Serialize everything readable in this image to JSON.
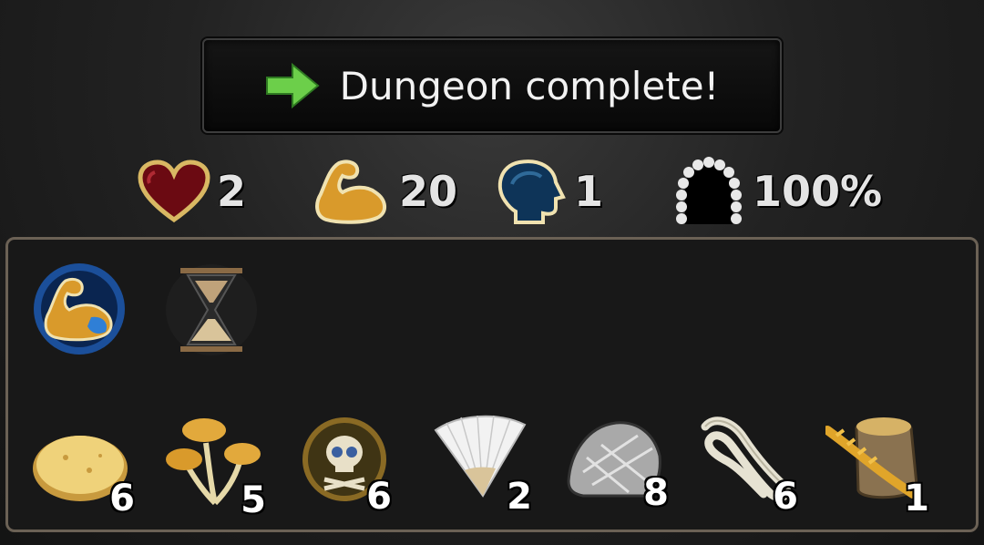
{
  "banner": {
    "title": "Dungeon complete!",
    "icon": "green-arrow-right-icon",
    "icon_color": "#6ccf4a"
  },
  "stats": [
    {
      "icon": "heart-icon",
      "value": "2"
    },
    {
      "icon": "muscle-arm-icon",
      "value": "20"
    },
    {
      "icon": "head-brain-icon",
      "value": "1"
    },
    {
      "icon": "doorway-arch-icon",
      "value": "100%"
    }
  ],
  "buffs": [
    {
      "icon": "strength-buff-icon"
    },
    {
      "icon": "hourglass-icon"
    }
  ],
  "items": [
    {
      "icon": "bread-flatbread-icon",
      "qty": "6"
    },
    {
      "icon": "mushrooms-icon",
      "qty": "5"
    },
    {
      "icon": "skull-coin-icon",
      "qty": "6"
    },
    {
      "icon": "folding-fan-icon",
      "qty": "2"
    },
    {
      "icon": "silver-ore-icon",
      "qty": "8"
    },
    {
      "icon": "rope-coil-icon",
      "qty": "6"
    },
    {
      "icon": "grain-sack-icon",
      "qty": "1"
    }
  ]
}
